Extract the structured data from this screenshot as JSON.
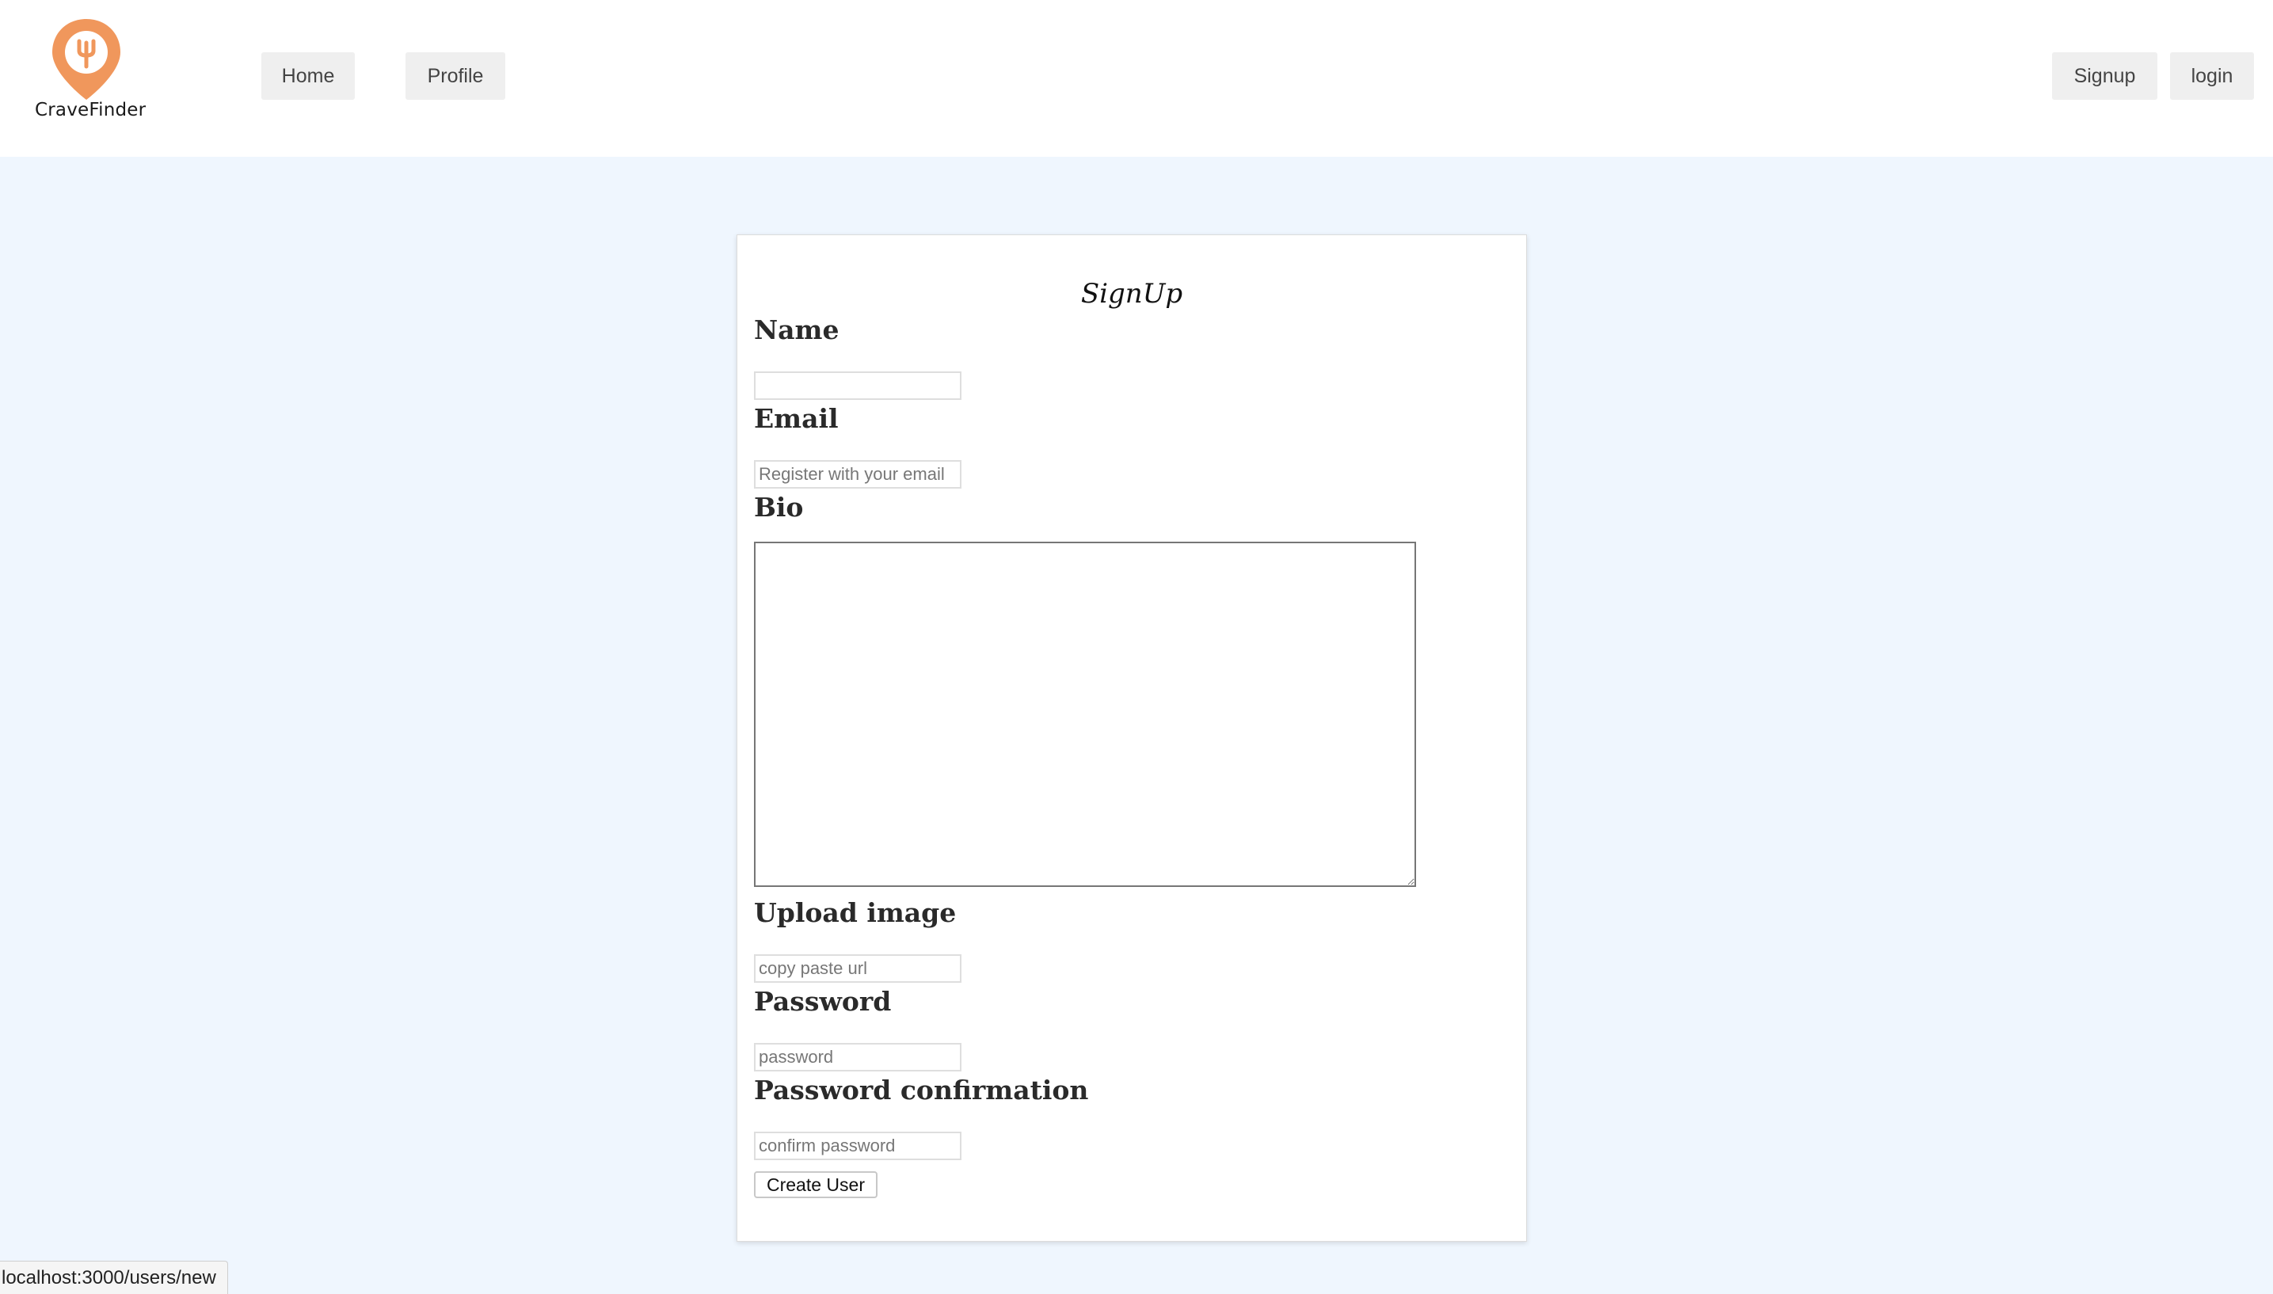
{
  "brand": {
    "name": "CraveFinder",
    "logo_icon": "fork-location-pin-icon",
    "accent_color": "#f0975c"
  },
  "nav": {
    "home_label": "Home",
    "profile_label": "Profile",
    "signup_label": "Signup",
    "login_label": "login"
  },
  "form": {
    "title": "SignUp",
    "name_label": "Name",
    "name_value": "",
    "email_label": "Email",
    "email_placeholder": "Register with your email",
    "bio_label": "Bio",
    "bio_value": "",
    "image_label": "Upload image",
    "image_placeholder": "copy paste url",
    "password_label": "Password",
    "password_placeholder": "password",
    "password_confirm_label": "Password confirmation",
    "password_confirm_placeholder": "confirm password",
    "submit_label": "Create User"
  },
  "status_bar": {
    "url": "localhost:3000/users/new"
  }
}
